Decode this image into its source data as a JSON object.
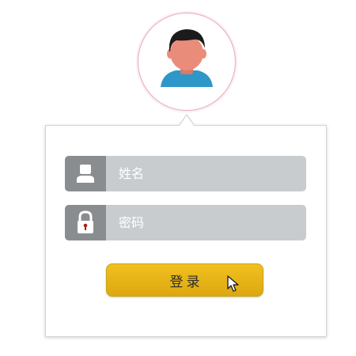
{
  "form": {
    "username_placeholder": "姓名",
    "password_placeholder": "密码",
    "login_label": "登录"
  },
  "icons": {
    "avatar": "user-avatar-icon",
    "username": "user-icon",
    "password": "padlock-icon",
    "cursor": "mouse-pointer-icon"
  },
  "colors": {
    "accent": "#E8B10F",
    "field_bg": "#C9CCCE",
    "icon_bg": "#8A8D90",
    "avatar_ring": "#E9A9B6",
    "avatar_shirt": "#2E97C9",
    "avatar_skin": "#E98C7A"
  }
}
